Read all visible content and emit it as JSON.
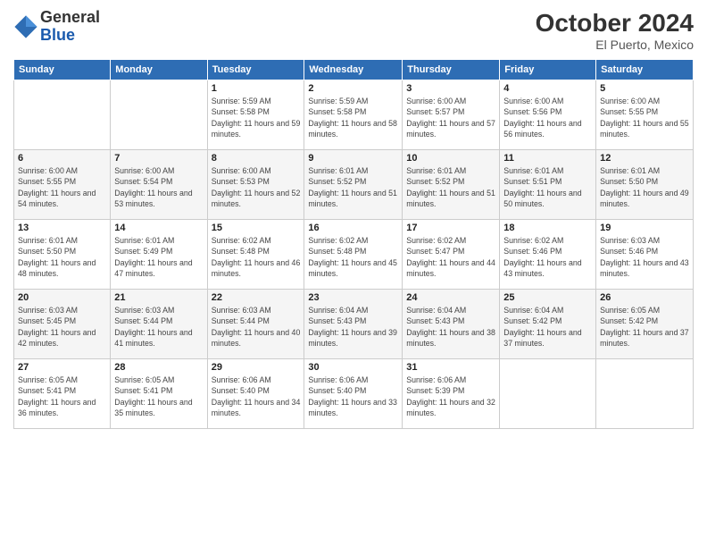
{
  "header": {
    "logo_line1": "General",
    "logo_line2": "Blue",
    "month_title": "October 2024",
    "subtitle": "El Puerto, Mexico"
  },
  "weekdays": [
    "Sunday",
    "Monday",
    "Tuesday",
    "Wednesday",
    "Thursday",
    "Friday",
    "Saturday"
  ],
  "weeks": [
    [
      {
        "day": "",
        "info": ""
      },
      {
        "day": "",
        "info": ""
      },
      {
        "day": "1",
        "info": "Sunrise: 5:59 AM\nSunset: 5:58 PM\nDaylight: 11 hours and 59 minutes."
      },
      {
        "day": "2",
        "info": "Sunrise: 5:59 AM\nSunset: 5:58 PM\nDaylight: 11 hours and 58 minutes."
      },
      {
        "day": "3",
        "info": "Sunrise: 6:00 AM\nSunset: 5:57 PM\nDaylight: 11 hours and 57 minutes."
      },
      {
        "day": "4",
        "info": "Sunrise: 6:00 AM\nSunset: 5:56 PM\nDaylight: 11 hours and 56 minutes."
      },
      {
        "day": "5",
        "info": "Sunrise: 6:00 AM\nSunset: 5:55 PM\nDaylight: 11 hours and 55 minutes."
      }
    ],
    [
      {
        "day": "6",
        "info": "Sunrise: 6:00 AM\nSunset: 5:55 PM\nDaylight: 11 hours and 54 minutes."
      },
      {
        "day": "7",
        "info": "Sunrise: 6:00 AM\nSunset: 5:54 PM\nDaylight: 11 hours and 53 minutes."
      },
      {
        "day": "8",
        "info": "Sunrise: 6:00 AM\nSunset: 5:53 PM\nDaylight: 11 hours and 52 minutes."
      },
      {
        "day": "9",
        "info": "Sunrise: 6:01 AM\nSunset: 5:52 PM\nDaylight: 11 hours and 51 minutes."
      },
      {
        "day": "10",
        "info": "Sunrise: 6:01 AM\nSunset: 5:52 PM\nDaylight: 11 hours and 51 minutes."
      },
      {
        "day": "11",
        "info": "Sunrise: 6:01 AM\nSunset: 5:51 PM\nDaylight: 11 hours and 50 minutes."
      },
      {
        "day": "12",
        "info": "Sunrise: 6:01 AM\nSunset: 5:50 PM\nDaylight: 11 hours and 49 minutes."
      }
    ],
    [
      {
        "day": "13",
        "info": "Sunrise: 6:01 AM\nSunset: 5:50 PM\nDaylight: 11 hours and 48 minutes."
      },
      {
        "day": "14",
        "info": "Sunrise: 6:01 AM\nSunset: 5:49 PM\nDaylight: 11 hours and 47 minutes."
      },
      {
        "day": "15",
        "info": "Sunrise: 6:02 AM\nSunset: 5:48 PM\nDaylight: 11 hours and 46 minutes."
      },
      {
        "day": "16",
        "info": "Sunrise: 6:02 AM\nSunset: 5:48 PM\nDaylight: 11 hours and 45 minutes."
      },
      {
        "day": "17",
        "info": "Sunrise: 6:02 AM\nSunset: 5:47 PM\nDaylight: 11 hours and 44 minutes."
      },
      {
        "day": "18",
        "info": "Sunrise: 6:02 AM\nSunset: 5:46 PM\nDaylight: 11 hours and 43 minutes."
      },
      {
        "day": "19",
        "info": "Sunrise: 6:03 AM\nSunset: 5:46 PM\nDaylight: 11 hours and 43 minutes."
      }
    ],
    [
      {
        "day": "20",
        "info": "Sunrise: 6:03 AM\nSunset: 5:45 PM\nDaylight: 11 hours and 42 minutes."
      },
      {
        "day": "21",
        "info": "Sunrise: 6:03 AM\nSunset: 5:44 PM\nDaylight: 11 hours and 41 minutes."
      },
      {
        "day": "22",
        "info": "Sunrise: 6:03 AM\nSunset: 5:44 PM\nDaylight: 11 hours and 40 minutes."
      },
      {
        "day": "23",
        "info": "Sunrise: 6:04 AM\nSunset: 5:43 PM\nDaylight: 11 hours and 39 minutes."
      },
      {
        "day": "24",
        "info": "Sunrise: 6:04 AM\nSunset: 5:43 PM\nDaylight: 11 hours and 38 minutes."
      },
      {
        "day": "25",
        "info": "Sunrise: 6:04 AM\nSunset: 5:42 PM\nDaylight: 11 hours and 37 minutes."
      },
      {
        "day": "26",
        "info": "Sunrise: 6:05 AM\nSunset: 5:42 PM\nDaylight: 11 hours and 37 minutes."
      }
    ],
    [
      {
        "day": "27",
        "info": "Sunrise: 6:05 AM\nSunset: 5:41 PM\nDaylight: 11 hours and 36 minutes."
      },
      {
        "day": "28",
        "info": "Sunrise: 6:05 AM\nSunset: 5:41 PM\nDaylight: 11 hours and 35 minutes."
      },
      {
        "day": "29",
        "info": "Sunrise: 6:06 AM\nSunset: 5:40 PM\nDaylight: 11 hours and 34 minutes."
      },
      {
        "day": "30",
        "info": "Sunrise: 6:06 AM\nSunset: 5:40 PM\nDaylight: 11 hours and 33 minutes."
      },
      {
        "day": "31",
        "info": "Sunrise: 6:06 AM\nSunset: 5:39 PM\nDaylight: 11 hours and 32 minutes."
      },
      {
        "day": "",
        "info": ""
      },
      {
        "day": "",
        "info": ""
      }
    ]
  ]
}
